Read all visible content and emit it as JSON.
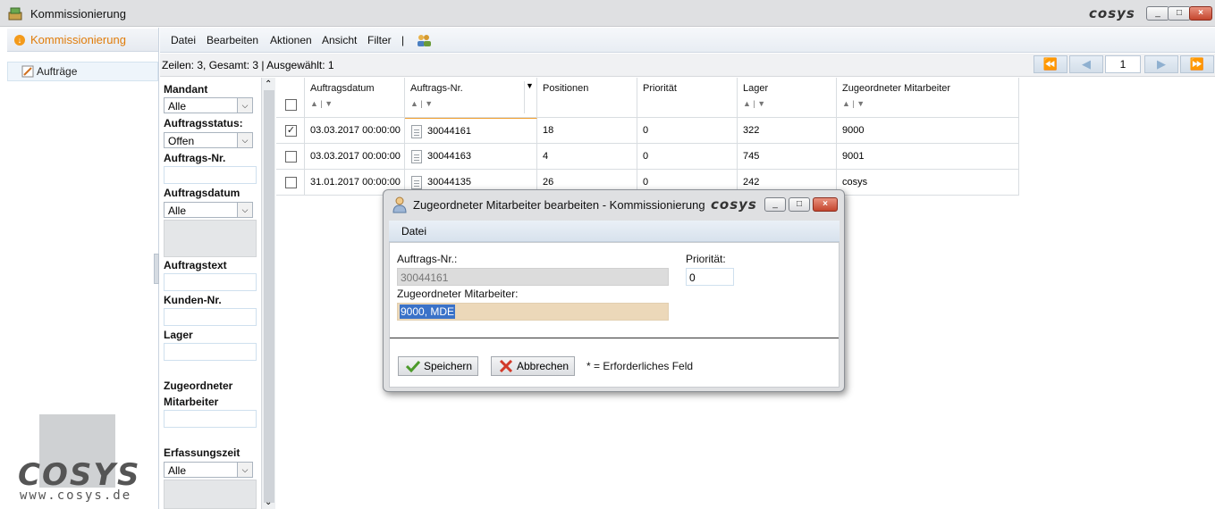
{
  "window": {
    "title": "Kommissionierung",
    "brand": "cosys",
    "controls": [
      "minimize",
      "maximize",
      "close"
    ]
  },
  "sidebar": {
    "header": "Kommissionierung",
    "items": [
      {
        "label": "Aufträge"
      }
    ],
    "brand_logo": "COSYS",
    "brand_url": "www.cosys.de"
  },
  "menu": {
    "items": [
      "Datei",
      "Bearbeiten",
      "Aktionen",
      "Ansicht",
      "Filter"
    ],
    "separator": "|"
  },
  "status": {
    "text": "Zeilen: 3, Gesamt: 3  |  Ausgewählt: 1",
    "page": "1"
  },
  "filters": {
    "mandant_label": "Mandant",
    "mandant_value": "Alle",
    "auftragsstatus_label": "Auftragsstatus:",
    "auftragsstatus_value": "Offen",
    "auftragsnr_label": "Auftrags-Nr.",
    "auftragsdatum_label": "Auftragsdatum",
    "auftragsdatum_value": "Alle",
    "auftragstext_label": "Auftragstext",
    "kundennr_label": "Kunden-Nr.",
    "lager_label": "Lager",
    "mitarbeiter_label_1": "Zugeordneter",
    "mitarbeiter_label_2": "Mitarbeiter",
    "erfassungszeit_label": "Erfassungszeit",
    "erfassungszeit_value": "Alle"
  },
  "grid": {
    "columns": [
      "Auftragsdatum",
      "Auftrags-Nr.",
      "Positionen",
      "Priorität",
      "Lager",
      "Zugeordneter Mitarbeiter"
    ],
    "rows": [
      {
        "checked": true,
        "datum": "03.03.2017 00:00:00",
        "nr": "30044161",
        "positionen": "18",
        "prioritaet": "0",
        "lager": "322",
        "mitarbeiter": "9000"
      },
      {
        "checked": false,
        "datum": "03.03.2017 00:00:00",
        "nr": "30044163",
        "positionen": "4",
        "prioritaet": "0",
        "lager": "745",
        "mitarbeiter": "9001"
      },
      {
        "checked": false,
        "datum": "31.01.2017 00:00:00",
        "nr": "30044135",
        "positionen": "26",
        "prioritaet": "0",
        "lager": "242",
        "mitarbeiter": "cosys"
      }
    ]
  },
  "dialog": {
    "title": "Zugeordneter Mitarbeiter bearbeiten - Kommissionierung",
    "brand": "cosys",
    "menu": "Datei",
    "auftragsnr_label": "Auftrags-Nr.:",
    "auftragsnr_value": "30044161",
    "prioritaet_label": "Priorität:",
    "prioritaet_value": "0",
    "mitarbeiter_label": "Zugeordneter Mitarbeiter:",
    "mitarbeiter_value": "9000, MDE",
    "save_label": "Speichern",
    "cancel_label": "Abbrechen",
    "required_note": "* = Erforderliches Feld"
  }
}
